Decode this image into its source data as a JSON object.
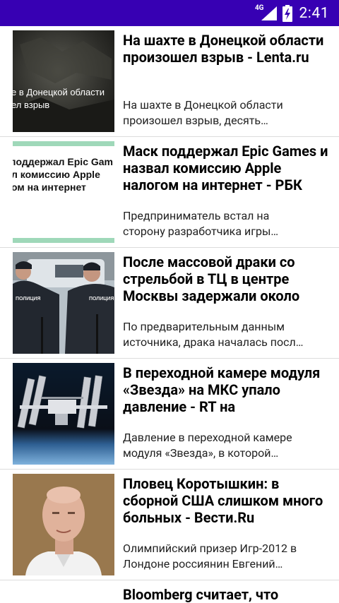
{
  "status_bar": {
    "network": "4G",
    "time": "2:41"
  },
  "feed": {
    "items": [
      {
        "title": "На шахте в Донецкой области произошел взрыв - Lenta.ru",
        "description": "На шахте в Донецкой области\nпроизошел взрыв, десять…",
        "thumb_text": [
          "е в Донецкой области",
          "ел взрыв"
        ]
      },
      {
        "title": "Маск поддержал Epic Games и назвал комиссию Apple налогом на интернет - РБК",
        "description": "Предприниматель встал на\nсторону разработчика игры…",
        "thumb_text": [
          "поддержал Epic Gam",
          "л комиссию Apple",
          "ом на интернет"
        ]
      },
      {
        "title": "После массовой драки со стрельбой в ТЦ в центре Москвы задержали около",
        "description": "По предварительным данным\nисточника, драка началась посл…",
        "thumb_text": [
          "ПОЛИЦИЯ",
          "ПОЛИЦИЯ"
        ]
      },
      {
        "title": "В переходной камере модуля «Звезда» на МКС упало давление - RT на",
        "description": "Давление в переходной камере\nмодуля «Звезда», в которой…"
      },
      {
        "title": "Пловец Коротышкин: в сборной США слишком много больных - Вести.Ru",
        "description": "Олимпийский призер Игр-2012 в\nЛондоне россиянин Евгений…"
      },
      {
        "title": "Bloomberg считает, что"
      }
    ]
  }
}
